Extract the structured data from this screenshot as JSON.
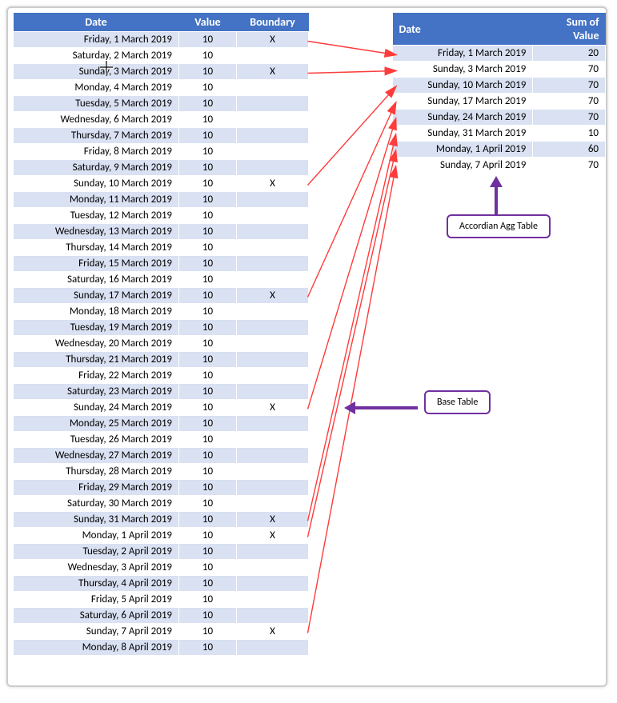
{
  "colors": {
    "header": "#4472C4",
    "band": "#D9E1F2",
    "arrows": "#FF3B3B",
    "callout": "#7030A0"
  },
  "base": {
    "headers": [
      "Date",
      "Value",
      "Boundary"
    ],
    "rows": [
      {
        "date": "Friday, 1 March 2019",
        "value": "10",
        "boundary": "X"
      },
      {
        "date": "Saturday, 2 March 2019",
        "value": "10",
        "boundary": ""
      },
      {
        "date": "Sunday, 3 March 2019",
        "value": "10",
        "boundary": "X"
      },
      {
        "date": "Monday, 4 March 2019",
        "value": "10",
        "boundary": ""
      },
      {
        "date": "Tuesday, 5 March 2019",
        "value": "10",
        "boundary": ""
      },
      {
        "date": "Wednesday, 6 March 2019",
        "value": "10",
        "boundary": ""
      },
      {
        "date": "Thursday, 7 March 2019",
        "value": "10",
        "boundary": ""
      },
      {
        "date": "Friday, 8 March 2019",
        "value": "10",
        "boundary": ""
      },
      {
        "date": "Saturday, 9 March 2019",
        "value": "10",
        "boundary": ""
      },
      {
        "date": "Sunday, 10 March 2019",
        "value": "10",
        "boundary": "X"
      },
      {
        "date": "Monday, 11 March 2019",
        "value": "10",
        "boundary": ""
      },
      {
        "date": "Tuesday, 12 March 2019",
        "value": "10",
        "boundary": ""
      },
      {
        "date": "Wednesday, 13 March 2019",
        "value": "10",
        "boundary": ""
      },
      {
        "date": "Thursday, 14 March 2019",
        "value": "10",
        "boundary": ""
      },
      {
        "date": "Friday, 15 March 2019",
        "value": "10",
        "boundary": ""
      },
      {
        "date": "Saturday, 16 March 2019",
        "value": "10",
        "boundary": ""
      },
      {
        "date": "Sunday, 17 March 2019",
        "value": "10",
        "boundary": "X"
      },
      {
        "date": "Monday, 18 March 2019",
        "value": "10",
        "boundary": ""
      },
      {
        "date": "Tuesday, 19 March 2019",
        "value": "10",
        "boundary": ""
      },
      {
        "date": "Wednesday, 20 March 2019",
        "value": "10",
        "boundary": ""
      },
      {
        "date": "Thursday, 21 March 2019",
        "value": "10",
        "boundary": ""
      },
      {
        "date": "Friday, 22 March 2019",
        "value": "10",
        "boundary": ""
      },
      {
        "date": "Saturday, 23 March 2019",
        "value": "10",
        "boundary": ""
      },
      {
        "date": "Sunday, 24 March 2019",
        "value": "10",
        "boundary": "X"
      },
      {
        "date": "Monday, 25 March 2019",
        "value": "10",
        "boundary": ""
      },
      {
        "date": "Tuesday, 26 March 2019",
        "value": "10",
        "boundary": ""
      },
      {
        "date": "Wednesday, 27 March 2019",
        "value": "10",
        "boundary": ""
      },
      {
        "date": "Thursday, 28 March 2019",
        "value": "10",
        "boundary": ""
      },
      {
        "date": "Friday, 29 March 2019",
        "value": "10",
        "boundary": ""
      },
      {
        "date": "Saturday, 30 March 2019",
        "value": "10",
        "boundary": ""
      },
      {
        "date": "Sunday, 31 March 2019",
        "value": "10",
        "boundary": "X"
      },
      {
        "date": "Monday, 1 April 2019",
        "value": "10",
        "boundary": "X"
      },
      {
        "date": "Tuesday, 2 April 2019",
        "value": "10",
        "boundary": ""
      },
      {
        "date": "Wednesday, 3 April 2019",
        "value": "10",
        "boundary": ""
      },
      {
        "date": "Thursday, 4 April 2019",
        "value": "10",
        "boundary": ""
      },
      {
        "date": "Friday, 5 April 2019",
        "value": "10",
        "boundary": ""
      },
      {
        "date": "Saturday, 6 April 2019",
        "value": "10",
        "boundary": ""
      },
      {
        "date": "Sunday, 7 April 2019",
        "value": "10",
        "boundary": "X"
      },
      {
        "date": "Monday, 8 April 2019",
        "value": "10",
        "boundary": ""
      }
    ]
  },
  "agg": {
    "headers": [
      "Date",
      "Sum of Value"
    ],
    "rows": [
      {
        "date": "Friday, 1 March 2019",
        "sum": "20"
      },
      {
        "date": "Sunday, 3 March 2019",
        "sum": "70"
      },
      {
        "date": "Sunday, 10 March 2019",
        "sum": "70"
      },
      {
        "date": "Sunday, 17 March 2019",
        "sum": "70"
      },
      {
        "date": "Sunday, 24 March 2019",
        "sum": "70"
      },
      {
        "date": "Sunday, 31 March 2019",
        "sum": "10"
      },
      {
        "date": "Monday, 1 April 2019",
        "sum": "60"
      },
      {
        "date": "Sunday, 7 April 2019",
        "sum": "70"
      }
    ]
  },
  "callouts": {
    "agg": "Accordian Agg Table",
    "base": "Base Table"
  },
  "arrows_from_base_to_agg": [
    {
      "from_base_row": 0,
      "to_agg_row": 0
    },
    {
      "from_base_row": 2,
      "to_agg_row": 1
    },
    {
      "from_base_row": 9,
      "to_agg_row": 2
    },
    {
      "from_base_row": 16,
      "to_agg_row": 3
    },
    {
      "from_base_row": 23,
      "to_agg_row": 4
    },
    {
      "from_base_row": 30,
      "to_agg_row": 5
    },
    {
      "from_base_row": 31,
      "to_agg_row": 6
    },
    {
      "from_base_row": 37,
      "to_agg_row": 7
    }
  ]
}
